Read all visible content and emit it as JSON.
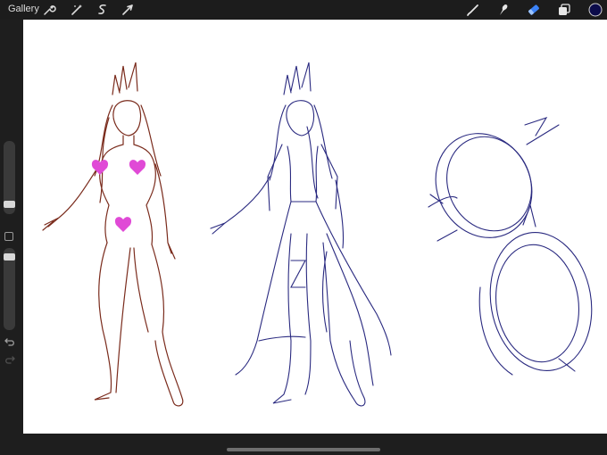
{
  "topbar": {
    "gallery_label": "Gallery",
    "left_tools": [
      {
        "name": "actions-icon"
      },
      {
        "name": "adjustments-icon"
      },
      {
        "name": "selection-icon"
      },
      {
        "name": "transform-icon"
      }
    ],
    "right_tools": [
      {
        "name": "brush-icon"
      },
      {
        "name": "smudge-icon"
      },
      {
        "name": "eraser-icon",
        "active": true
      },
      {
        "name": "layers-icon"
      },
      {
        "name": "color-swatch"
      }
    ],
    "current_color": "#0b0b4a",
    "active_tool_color": "#3b82f6"
  },
  "sidebar": {
    "brush_size_slider": {
      "value": 0.35
    },
    "opacity_slider": {
      "value": 0.3
    }
  },
  "canvas": {
    "background": "#ffffff",
    "sketch_colors": [
      "#7a2b1c",
      "#2a2a80",
      "#e04ad6"
    ]
  }
}
